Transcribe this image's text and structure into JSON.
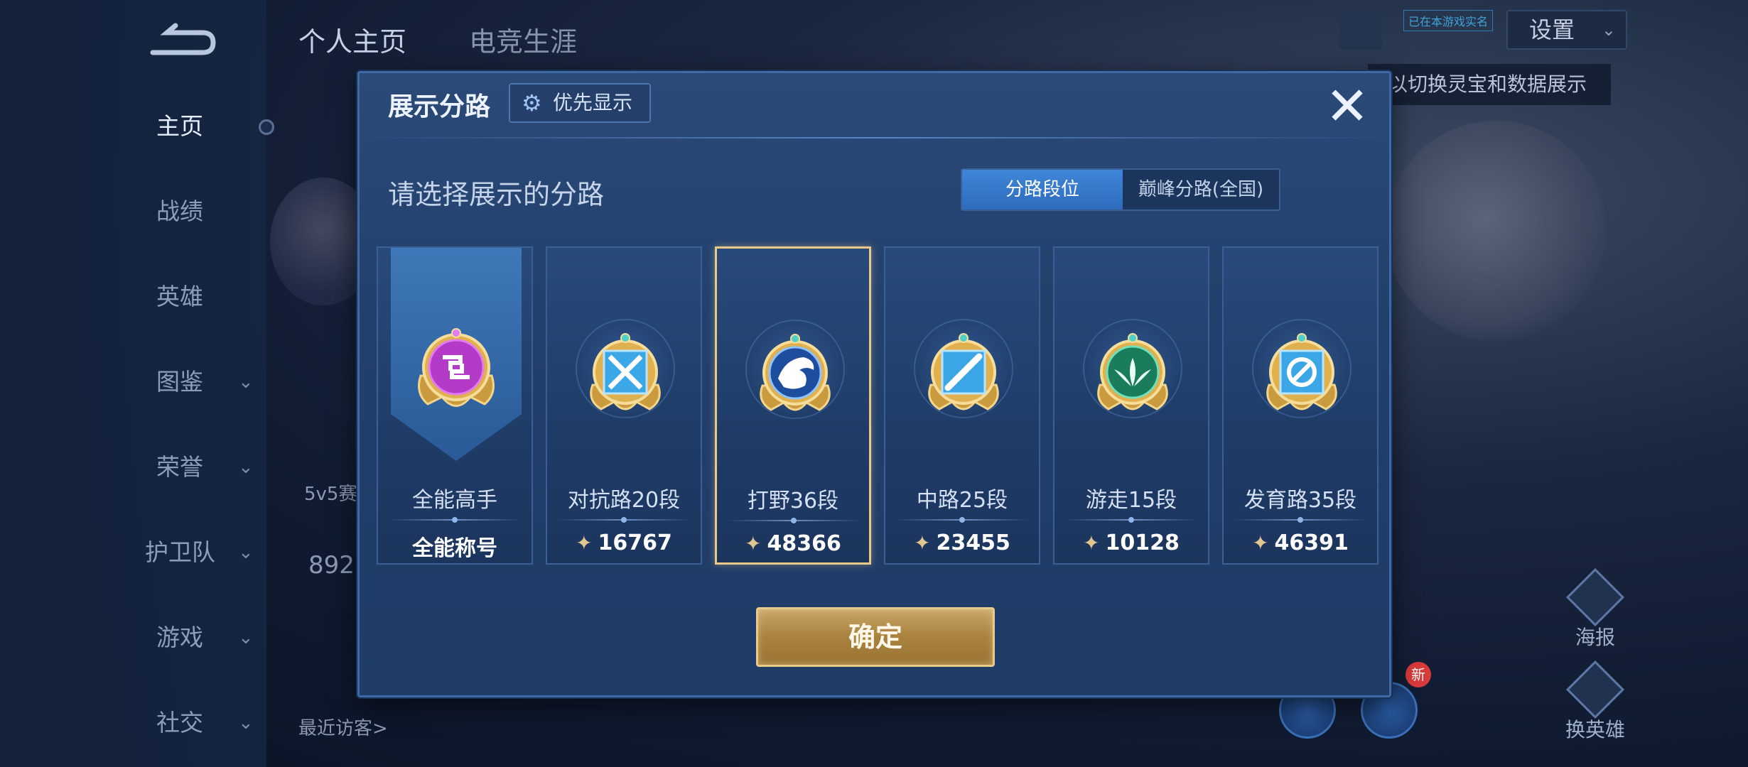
{
  "background": {
    "top_tabs": [
      "个人主页",
      "电竞生涯"
    ],
    "sidebar": [
      {
        "label": "主页",
        "expand": false
      },
      {
        "label": "战绩",
        "expand": false
      },
      {
        "label": "英雄",
        "expand": false
      },
      {
        "label": "图鉴",
        "expand": true
      },
      {
        "label": "荣誉",
        "expand": true
      },
      {
        "label": "护卫队",
        "expand": true
      },
      {
        "label": "游戏",
        "expand": true
      },
      {
        "label": "社交",
        "expand": true
      }
    ],
    "settings_label": "设置",
    "verified_tag": "已在本游戏实名",
    "switch_tip": "以切换灵宝和数据展示",
    "left_text_5v5": "5v5赛",
    "left_number": "892",
    "recent_visitors": "最近访客>",
    "poster_label": "海报",
    "swap_hero_label": "换英雄",
    "new_badge": "新"
  },
  "modal": {
    "title": "展示分路",
    "priority_label": "优先显示",
    "close_symbol": "✕",
    "subtitle": "请选择展示的分路",
    "toggle": {
      "active": "分路段位",
      "inactive": "巅峰分路(全国)"
    },
    "cards": [
      {
        "name": "全能高手",
        "score": "全能称号",
        "badge": "purple",
        "selected": false,
        "has_points": false
      },
      {
        "name": "对抗路20段",
        "score": "16767",
        "badge": "clash",
        "selected": false,
        "has_points": true
      },
      {
        "name": "打野36段",
        "score": "48366",
        "badge": "jungle",
        "selected": true,
        "has_points": true
      },
      {
        "name": "中路25段",
        "score": "23455",
        "badge": "mid",
        "selected": false,
        "has_points": true
      },
      {
        "name": "游走15段",
        "score": "10128",
        "badge": "roam",
        "selected": false,
        "has_points": true
      },
      {
        "name": "发育路35段",
        "score": "46391",
        "badge": "farm",
        "selected": false,
        "has_points": true
      }
    ],
    "confirm_label": "确定"
  },
  "colors": {
    "gold": "#e1c58e",
    "accent_blue": "#3f86d8",
    "badge_purple": "#b43bc8",
    "badge_green": "#2aa07a"
  }
}
